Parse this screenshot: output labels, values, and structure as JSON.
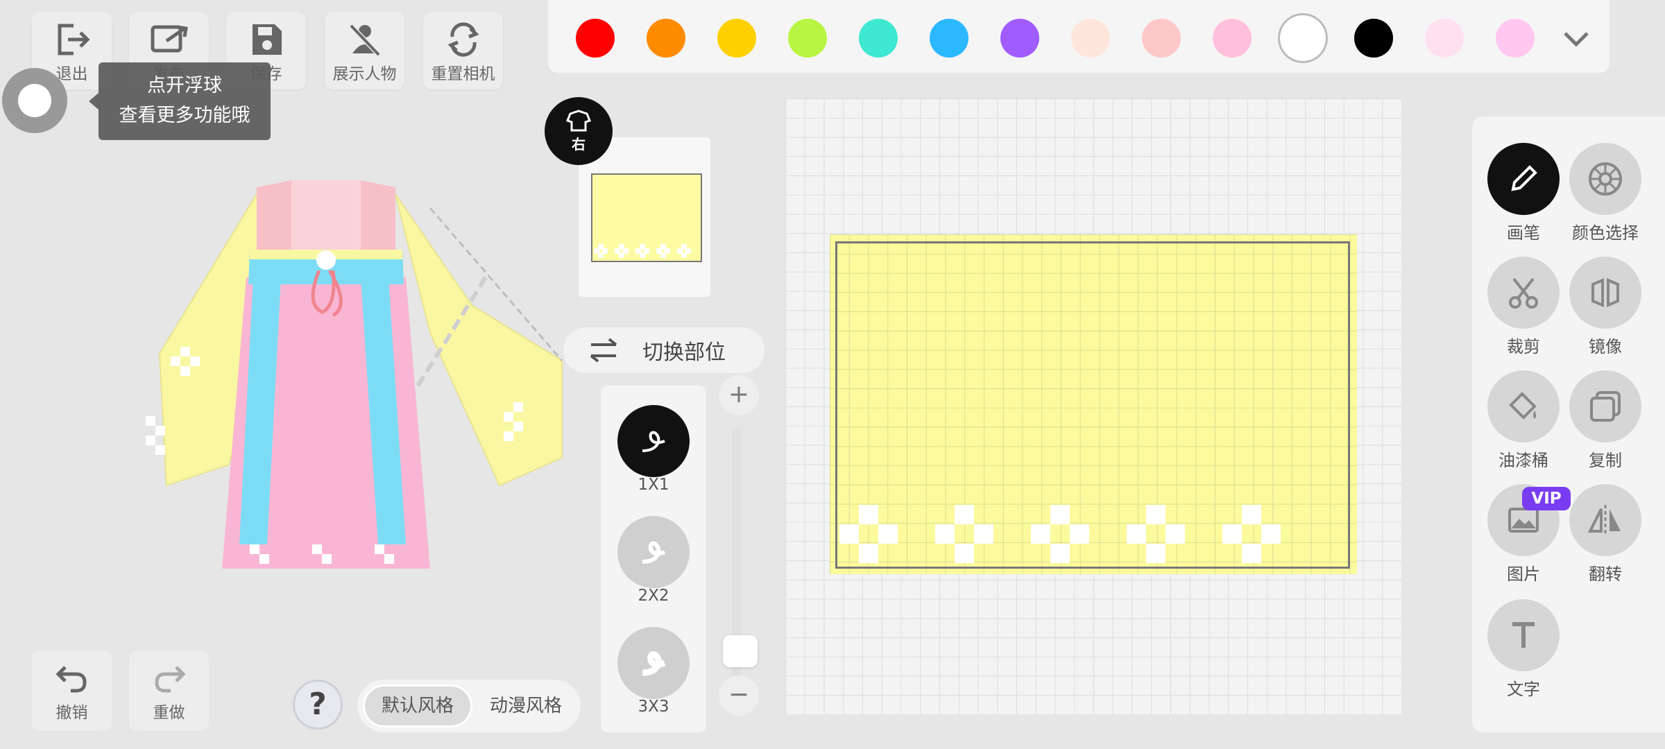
{
  "top_tools": {
    "exit_label": "退出",
    "publish_label": "发布",
    "save_label": "保存",
    "show_character_label": "展示人物",
    "reset_camera_label": "重置相机"
  },
  "tooltip": {
    "line1": "点开浮球",
    "line2": "查看更多功能哦"
  },
  "palette": {
    "colors": [
      "#ff0000",
      "#ff8c00",
      "#ffd000",
      "#b8f542",
      "#3ee8d2",
      "#2bb8ff",
      "#a05cff",
      "#ffe6dc",
      "#ffc8c8",
      "#ffc0dc",
      "#ffffff",
      "#000000",
      "#ffe0ef",
      "#ffc8f0"
    ],
    "selected_index": 10,
    "expand_icon": "chevron-down-icon"
  },
  "side_badge": {
    "label": "右"
  },
  "switch_part": {
    "label": "切换部位"
  },
  "brushes": [
    {
      "label": "1X1"
    },
    {
      "label": "2X2"
    },
    {
      "label": "3X3"
    }
  ],
  "zoom": {
    "plus": "+",
    "minus": "−",
    "level": 0.1
  },
  "right_tools": {
    "pen": "画笔",
    "color_picker": "颜色选择",
    "crop": "裁剪",
    "mirror": "镜像",
    "bucket": "油漆桶",
    "copy": "复制",
    "image": "图片",
    "flip": "翻转",
    "text": "文字",
    "vip": "VIP"
  },
  "bottom": {
    "undo_label": "撤销",
    "redo_label": "重做",
    "help": "?",
    "style_default": "默认风格",
    "style_anime": "动漫风格"
  },
  "colors": {
    "fabric": "#fbfa9c",
    "accent_dark": "#111111",
    "vip": "#7a3cf0"
  }
}
